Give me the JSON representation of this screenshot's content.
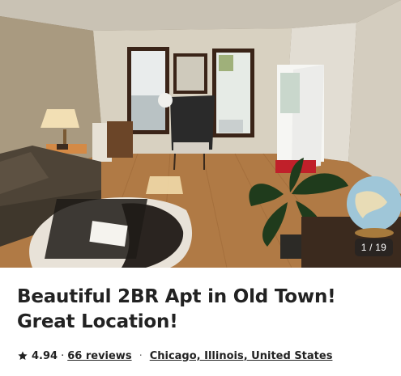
{
  "listing": {
    "title": "Beautiful 2BR Apt in Old Town! Great Location!",
    "rating": "4.94",
    "rating_separator": "·",
    "reviews_link": "66 reviews",
    "meta_dot": "·",
    "location_link": "Chicago, Illinois, United States"
  },
  "gallery": {
    "counter": "1 / 19",
    "photo_description_icon": "living-room-photo"
  },
  "colors": {
    "text": "#222222",
    "counter_bg": "#222222",
    "floor": "#b07a45",
    "wall": "#d9d2c4"
  }
}
